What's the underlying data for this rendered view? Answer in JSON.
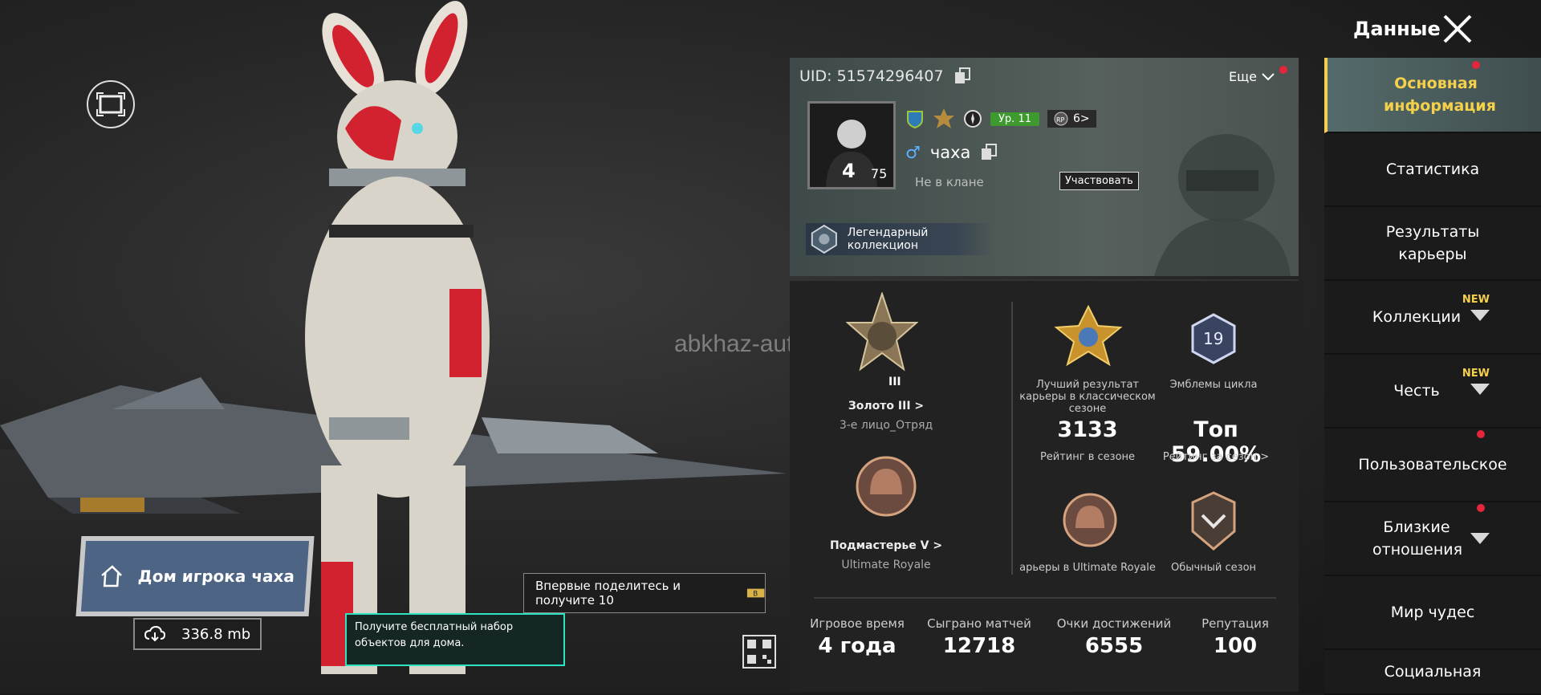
{
  "header": {
    "title": "Данные",
    "close_icon": "close-icon"
  },
  "watermark": "abkhaz-auto.ru",
  "profile": {
    "uid": "UID: 51574296407",
    "more_label": "Еще",
    "level_label": "Ур. 11",
    "rp_label": "6>",
    "avatar_number": "4",
    "avatar_level": "75",
    "gender_symbol": "♂",
    "player_name": "чаха",
    "clan_status": "Не в клане",
    "join_button": "Участвовать",
    "collection_label": "Легендарный коллекцион"
  },
  "stats": {
    "classic_rank": {
      "name": "Золото III  >",
      "mode": "3-е лицо_Отряд"
    },
    "ultimate_rank": {
      "name": "Подмастерье V  >",
      "mode": "Ultimate Royale"
    },
    "best_career_label": "Лучший результат карьеры в классическом сезоне",
    "cycle_emblems_label": "Эмблемы цикла",
    "season_rating_value": "3133",
    "season_rating_label": "Рейтинг в сезоне",
    "top_value": "Топ 59.00%",
    "top_label": "Рейтинг за сезон >",
    "career_ultimate_label": "арьеры в Ultimate Royale",
    "ordinary_season_label": "Обычный сезон",
    "emblem_cycle_number": "19",
    "rank_roman": "III",
    "bottom": [
      {
        "label": "Игровое время",
        "value": "4 года"
      },
      {
        "label": "Сыграно матчей",
        "value": "12718"
      },
      {
        "label": "Очки достижений",
        "value": "6555"
      },
      {
        "label": "Репутация",
        "value": "100"
      }
    ]
  },
  "home": {
    "title": "Дом игрока чаха",
    "storage": "336.8 mb",
    "share_text": "Впервые поделитесь и получите 10",
    "tip_text": "Получите бесплатный набор объектов для дома."
  },
  "nav": {
    "items": [
      {
        "label": "Основная информация"
      },
      {
        "label": "Статистика"
      },
      {
        "label": "Результаты карьеры"
      },
      {
        "label": "Коллекции",
        "badge": "NEW"
      },
      {
        "label": "Честь",
        "badge": "NEW"
      },
      {
        "label": "Пользовательское"
      },
      {
        "label": "Близкие отношения"
      },
      {
        "label": "Мир чудес"
      },
      {
        "label": "Социальная"
      }
    ]
  },
  "colors": {
    "accent_yellow": "#f5d04a",
    "level_green": "#3e9a2e",
    "notify_red": "#e3263b",
    "tip_cyan": "#2fe3c0"
  }
}
